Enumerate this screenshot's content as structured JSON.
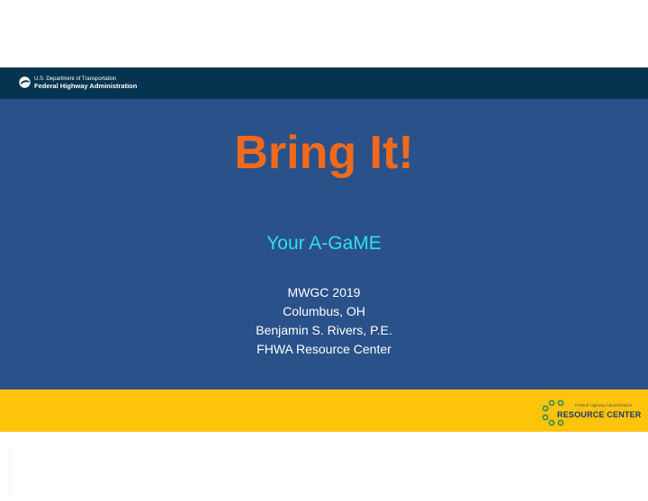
{
  "header": {
    "agency_line1": "U.S. Department of Transportation",
    "agency_line2": "Federal Highway Administration",
    "logo_icon": "dot-logo-icon"
  },
  "slide": {
    "title": "Bring It!",
    "subtitle": "Your A-GaME",
    "details": [
      "MWGC 2019",
      "Columbus, OH",
      "Benjamin S. Rivers, P.E.",
      "FHWA Resource Center"
    ]
  },
  "footer": {
    "logo_small_text": "Federal Highway Administration",
    "logo_text": "RESOURCE CENTER"
  },
  "colors": {
    "header_band": "#04344f",
    "main_band": "#2a5189",
    "title": "#f06a1d",
    "subtitle": "#2ee0e8",
    "footer_band": "#fec30b"
  }
}
